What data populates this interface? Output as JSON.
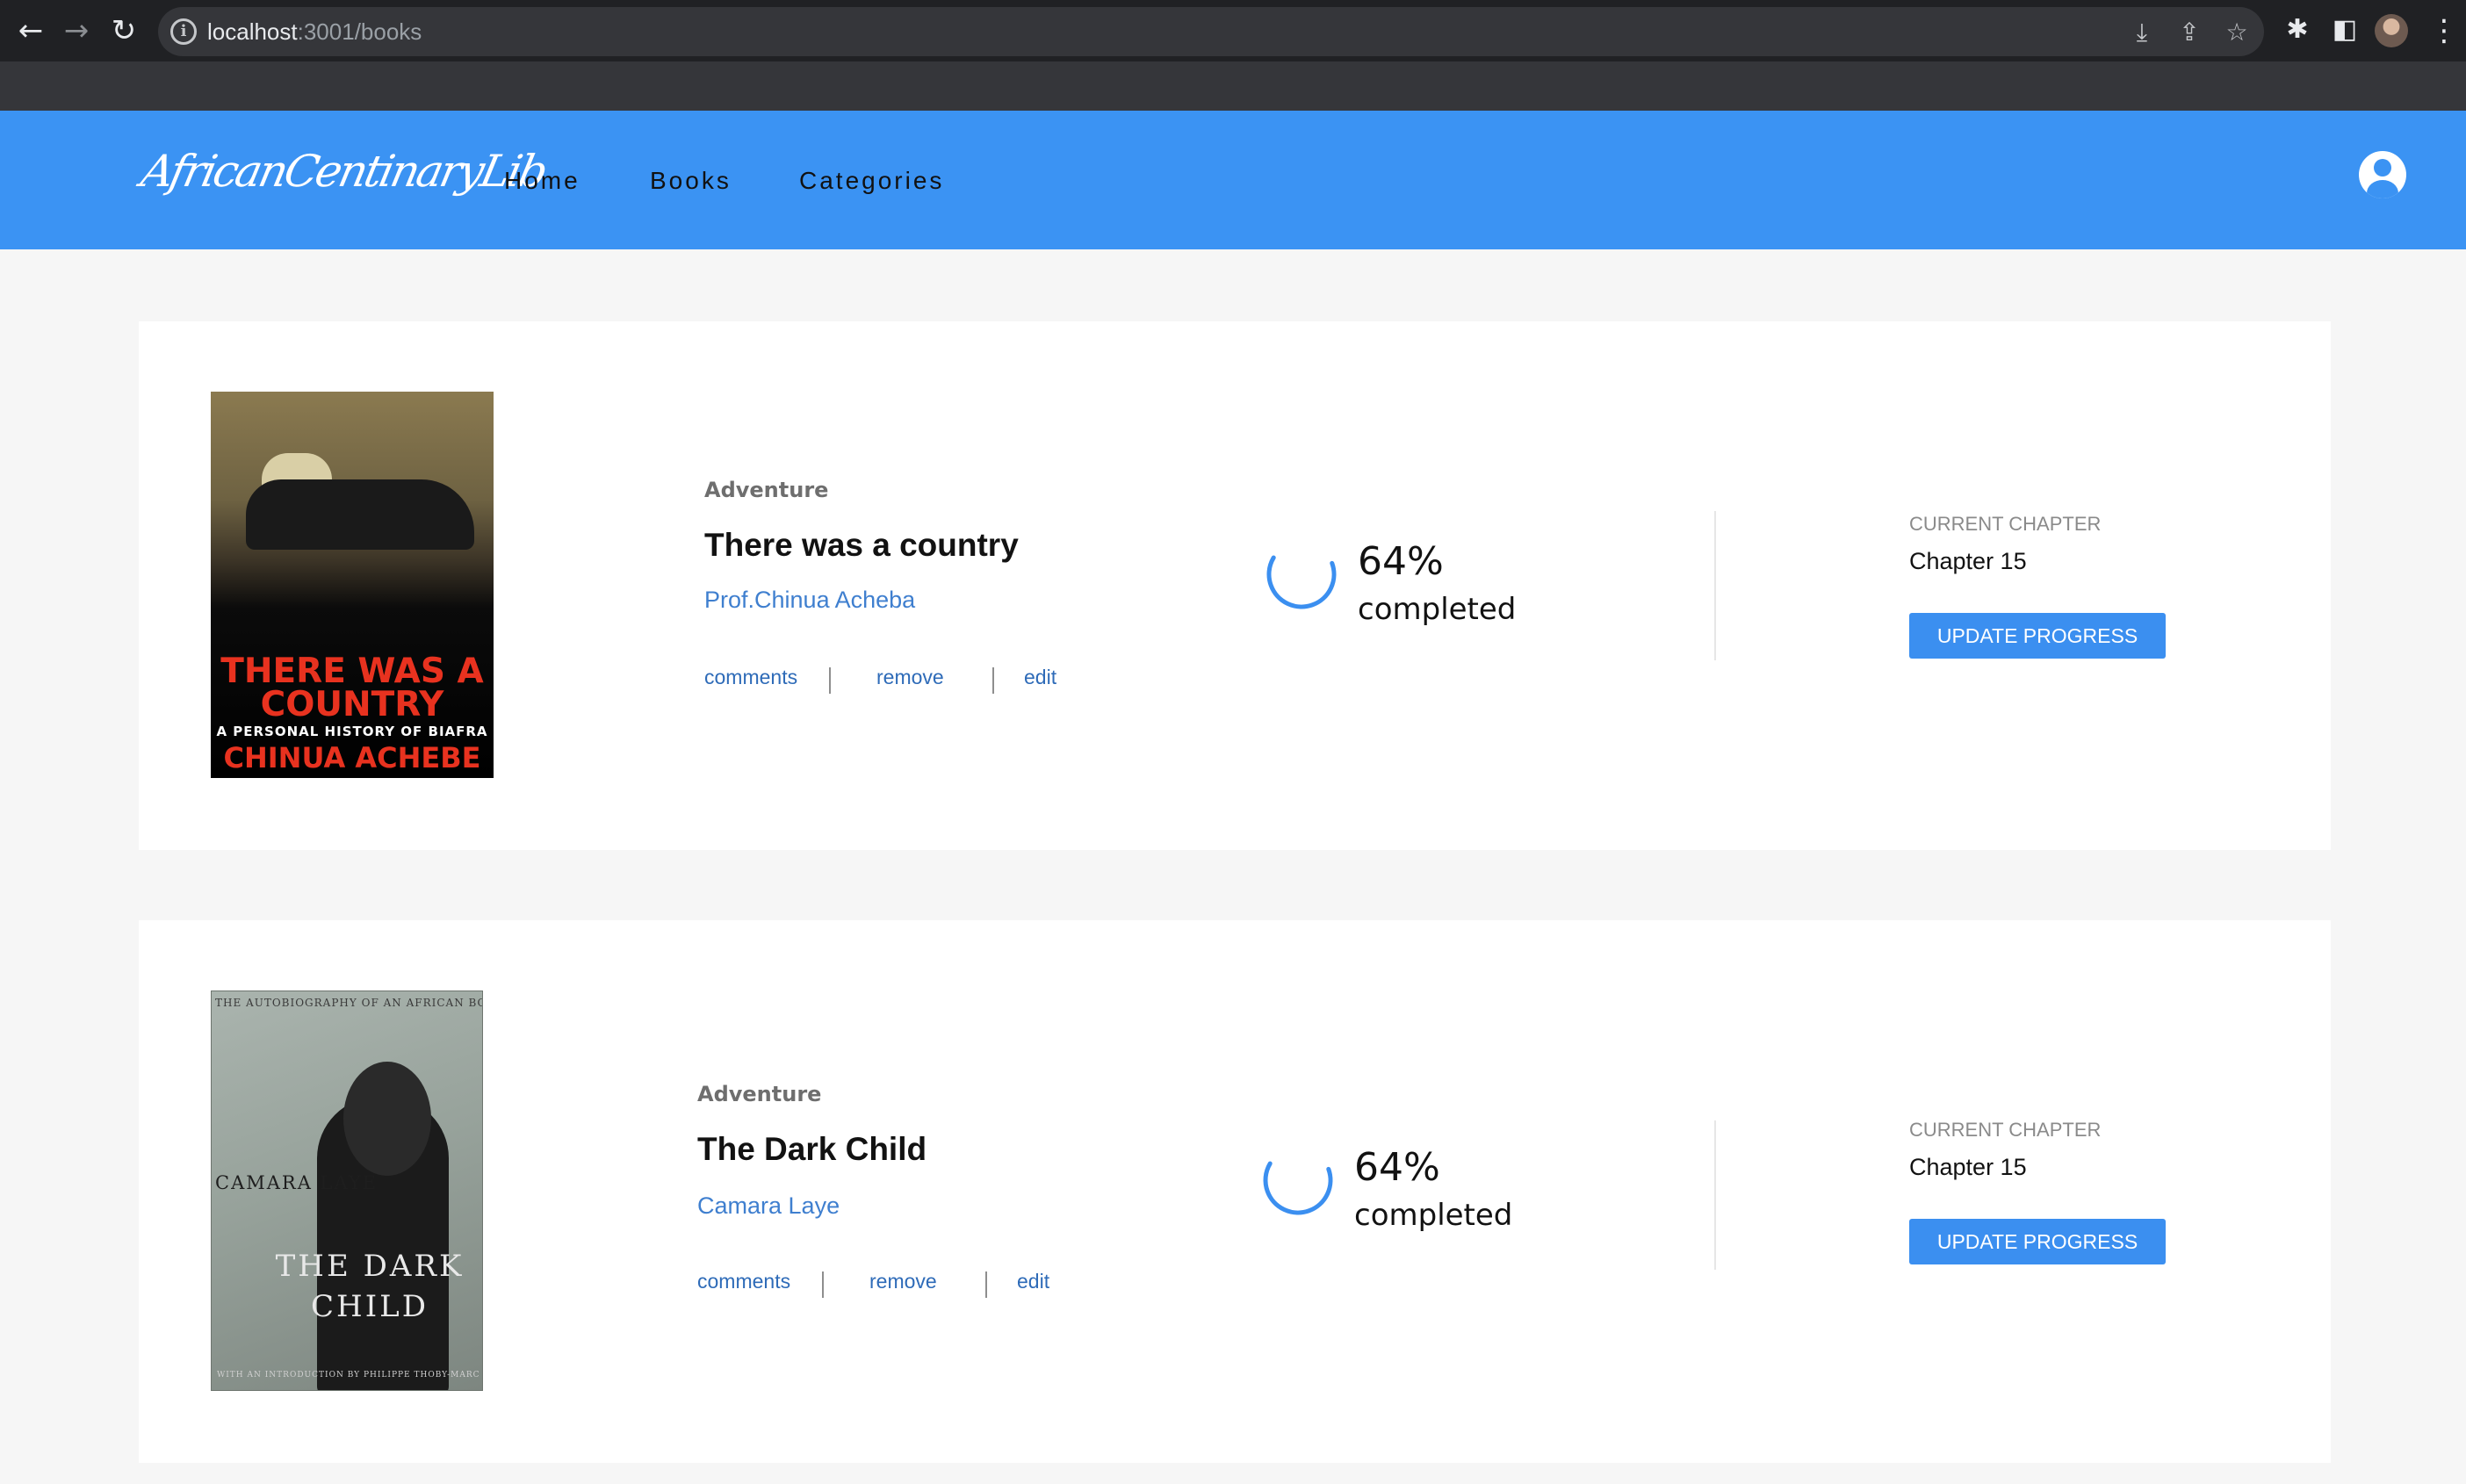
{
  "browser": {
    "url_host": "localhost",
    "url_path": ":3001/books",
    "icons": {
      "back": "back-arrow-icon",
      "forward": "forward-arrow-icon",
      "reload": "reload-icon",
      "site_info": "info-icon",
      "install": "install-icon",
      "share": "share-icon",
      "bookmark": "star-icon",
      "extensions": "puzzle-icon",
      "side_panel": "side-panel-icon",
      "menu": "kebab-menu-icon"
    }
  },
  "app": {
    "logo": "AfricanCentinaryLib",
    "nav": [
      "Home",
      "Books",
      "Categories"
    ],
    "accent_color": "#3b93f3"
  },
  "books": [
    {
      "genre": "Adventure",
      "title": "There was a country",
      "author": "Prof.Chinua Acheba",
      "actions": [
        "comments",
        "remove",
        "edit"
      ],
      "progress_percent": 64,
      "progress_label": "64%",
      "completed_label": "completed",
      "current_chapter_label": "CURRENT CHAPTER",
      "current_chapter": "Chapter 15",
      "update_button": "UPDATE PROGRESS",
      "cover": {
        "line1": "THERE WAS A COUNTRY",
        "line2": "A PERSONAL HISTORY OF BIAFRA",
        "line3": "CHINUA ACHEBE"
      }
    },
    {
      "genre": "Adventure",
      "title": "The Dark Child",
      "author": "Camara Laye",
      "actions": [
        "comments",
        "remove",
        "edit"
      ],
      "progress_percent": 64,
      "progress_label": "64%",
      "completed_label": "completed",
      "current_chapter_label": "CURRENT CHAPTER",
      "current_chapter": "Chapter 15",
      "update_button": "UPDATE PROGRESS",
      "cover": {
        "line0": "THE AUTOBIOGRAPHY OF AN AFRICAN BOY",
        "line1": "CAMARA LAYE",
        "line2": "THE DARK CHILD",
        "line3": "WITH AN INTRODUCTION BY PHILIPPE THOBY-MARCELIN"
      }
    }
  ]
}
